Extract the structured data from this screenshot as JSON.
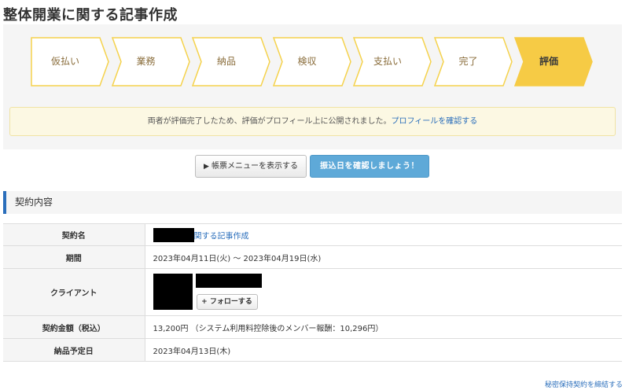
{
  "page": {
    "title": "整体開業に関する記事作成"
  },
  "progress": {
    "steps": [
      {
        "label": "仮払い",
        "state": "done"
      },
      {
        "label": "業務",
        "state": "done"
      },
      {
        "label": "納品",
        "state": "done"
      },
      {
        "label": "検収",
        "state": "done"
      },
      {
        "label": "支払い",
        "state": "done"
      },
      {
        "label": "完了",
        "state": "done"
      },
      {
        "label": "評価",
        "state": "active"
      }
    ],
    "colors": {
      "inactive_fill": "#ffffff",
      "inactive_border": "#f5d24c",
      "active_fill": "#f6cb45"
    }
  },
  "notice": {
    "text": "両者が評価完了したため、評価がプロフィール上に公開されました。",
    "link": "プロフィールを確認する"
  },
  "actions": {
    "menu_icon": "▶",
    "menu_label": "帳票メニューを表示する",
    "confirm_label": "振込日を確認しましょう！"
  },
  "section": {
    "title": "契約内容"
  },
  "contract": {
    "name_label": "契約名",
    "name_value": "関する記事作成",
    "period_label": "期間",
    "period_value": "2023年04月11日(火) 〜 2023年04月19日(水)",
    "client_label": "クライアント",
    "follow_label": "+ フォローする",
    "amount_label": "契約金額（税込）",
    "amount_value": "13,200円 （システム利用料控除後のメンバー報酬：10,296円）",
    "delivery_label": "納品予定日",
    "delivery_value": "2023年04月13日(木)"
  },
  "footer": {
    "nda_link": "秘密保持契約を締結する"
  }
}
